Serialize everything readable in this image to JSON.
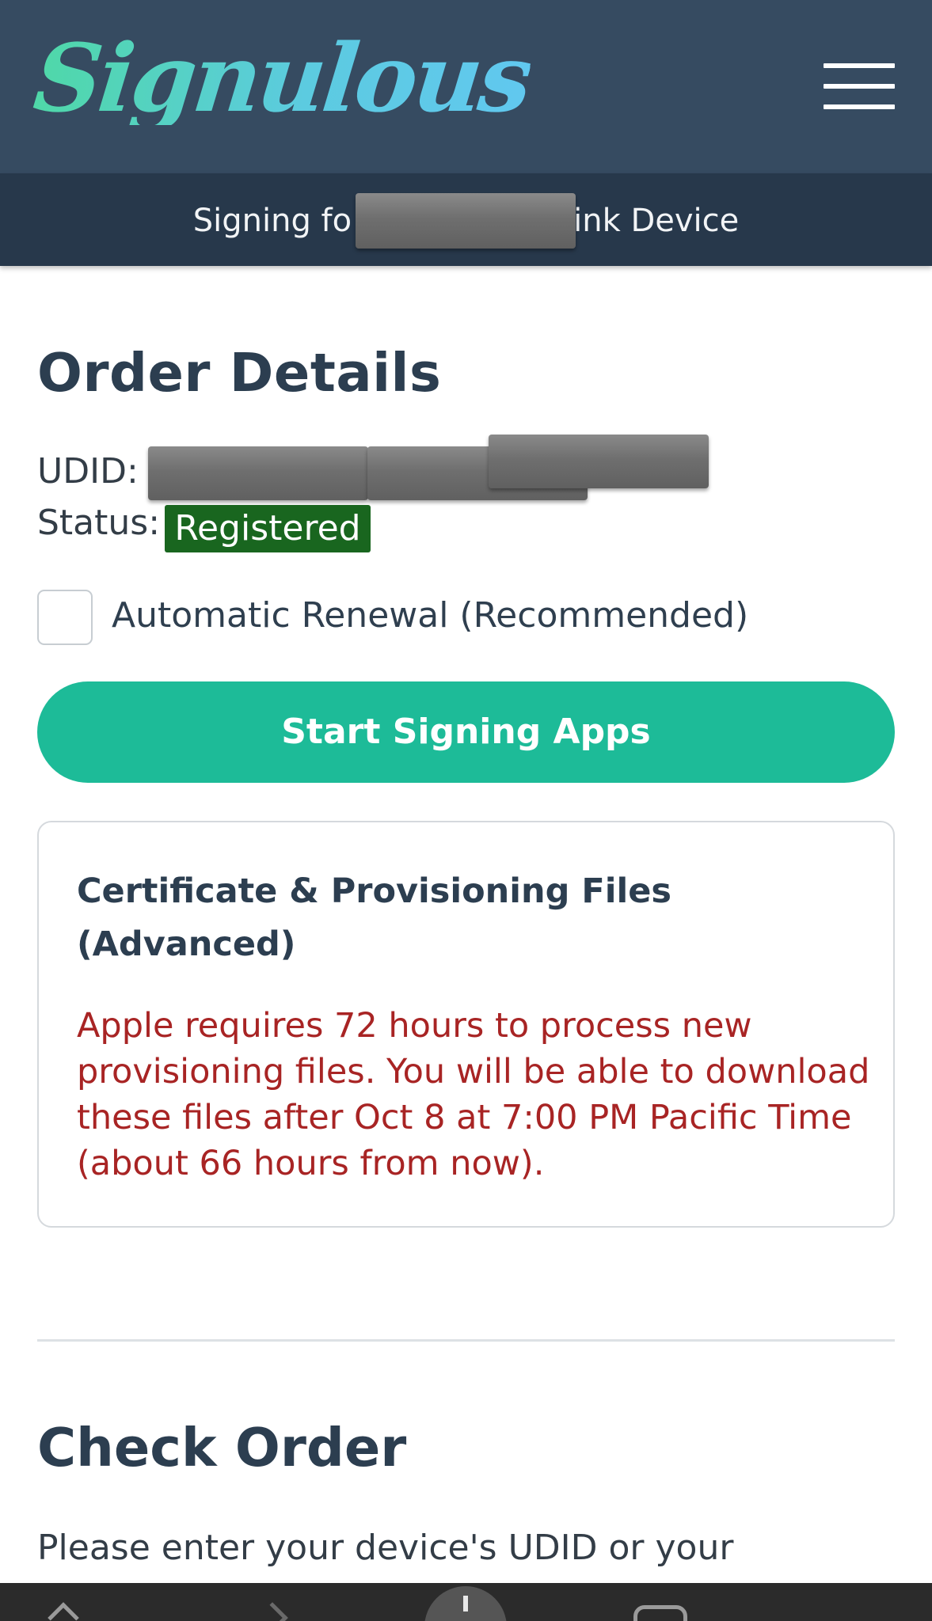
{
  "header": {
    "logo_text": "Signulous",
    "menu_icon": "hamburger-menu-icon",
    "subbar_left": "Signing fo",
    "subbar_right": "ink Device"
  },
  "order": {
    "title": "Order Details",
    "udid_label": "UDID:",
    "status_label": "Status:",
    "status_value": "Registered",
    "renewal_label": "Automatic Renewal (Recommended)",
    "renewal_checked": false,
    "start_button": "Start Signing Apps"
  },
  "certificate": {
    "title": "Certificate & Provisioning Files (Advanced)",
    "warning": "Apple requires 72 hours to process new provisioning files. You will be able to download these files after Oct 8 at 7:00 PM Pacific Time (about 66 hours from now)."
  },
  "check_order": {
    "title": "Check Order",
    "text": "Please enter your device's UDID or your"
  },
  "colors": {
    "header_bg": "#364b61",
    "subbar_bg": "#27384b",
    "accent_button": "#1dbb98",
    "status_badge": "#19661f",
    "warning_text": "#a82424",
    "heading_text": "#2c3e50"
  },
  "browser_bar": {
    "icons": [
      "back-icon",
      "forward-icon",
      "new-tab-plus-icon",
      "tabs-icon"
    ]
  }
}
